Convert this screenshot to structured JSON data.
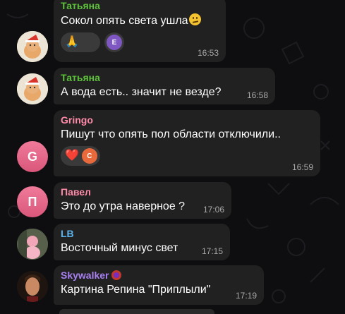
{
  "colors": {
    "background": "#0e0e10",
    "bubble": "#212121",
    "text": "#ffffff",
    "time": "#a9a9a9",
    "name_tatyana": "#5ec13b",
    "name_gringo": "#ff8aa8",
    "name_pavel": "#ff8aa8",
    "name_lb": "#5ab4ef",
    "name_skywalker": "#a880f0"
  },
  "messages": [
    {
      "sender": "Татьяна",
      "text": "Сокол опять света ушла",
      "trailing_emoji": "confused-face-emoji",
      "time": "16:53",
      "reactions": [
        {
          "emoji": "🙏",
          "avatar_letter": ""
        },
        {
          "emoji": "",
          "avatar_letter": "E"
        }
      ]
    },
    {
      "sender": "Татьяна",
      "text": "А вода есть.. значит не везде?",
      "time": "16:58"
    },
    {
      "sender": "Gringo",
      "text": "Пишут что опять пол области отключили..",
      "time": "16:59",
      "avatar_letter": "G",
      "reactions": [
        {
          "emoji": "❤️",
          "avatar_letter": "C"
        }
      ]
    },
    {
      "sender": "Павел",
      "text": "Это до утра наверное ?",
      "time": "17:06",
      "avatar_letter": "П"
    },
    {
      "sender": "LB",
      "text": "Восточный минус свет",
      "time": "17:15"
    },
    {
      "sender": "Skywalker",
      "sender_badge": "planet-badge-icon",
      "text": "Картина Репина \"Приплыли\"",
      "time": "17:19"
    }
  ]
}
